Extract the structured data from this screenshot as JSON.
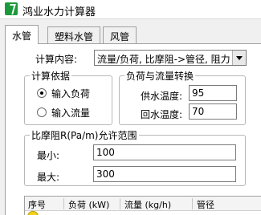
{
  "window": {
    "title": "鸿业水力计算器",
    "icon": "app-logo-icon"
  },
  "tabs": [
    {
      "label": "水管",
      "active": true
    },
    {
      "label": "塑料水管",
      "active": false
    },
    {
      "label": "风管",
      "active": false
    }
  ],
  "calc_content": {
    "label": "计算内容:",
    "value": "流量/负荷, 比摩阻->管径, 阻力"
  },
  "basis": {
    "title": "计算依据",
    "options": [
      {
        "label": "输入负荷",
        "selected": true
      },
      {
        "label": "输入流量",
        "selected": false
      }
    ]
  },
  "conversion": {
    "title": "负荷与流量转换",
    "supply_label": "供水温度:",
    "supply_value": "95",
    "return_label": "回水温度:",
    "return_value": "70"
  },
  "range": {
    "title": "比摩阻R(Pa/m)允许范围",
    "min_label": "最小:",
    "min_value": "100",
    "max_label": "最大:",
    "max_value": "300"
  },
  "table": {
    "columns": [
      "序号",
      "负荷 (kW)",
      "流量 (kg/h)",
      "管径"
    ]
  }
}
